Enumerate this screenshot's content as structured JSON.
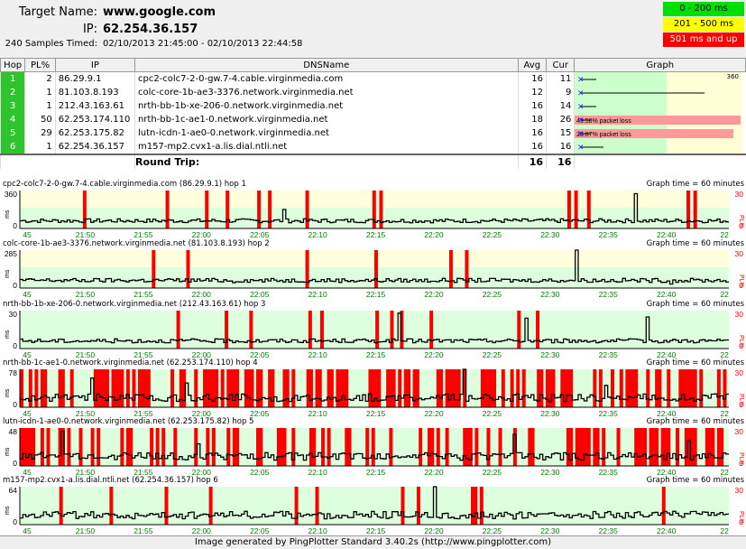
{
  "header": {
    "target_name_label": "Target Name:",
    "target_name": "www.google.com",
    "ip_label": "IP:",
    "ip": "62.254.36.157",
    "samples_label": "240 Samples Timed:",
    "samples_range": "02/10/2013 21:45:00 - 02/10/2013 22:44:58"
  },
  "legend": {
    "items": [
      {
        "label": "0 - 200 ms",
        "color": "#00e000"
      },
      {
        "label": "201 - 500 ms",
        "color": "#ffff00"
      },
      {
        "label": "501 ms and up",
        "color": "#ff0000"
      }
    ]
  },
  "table": {
    "columns": [
      "Hop",
      "PL%",
      "IP",
      "DNSName",
      "Avg",
      "Cur",
      "Graph"
    ],
    "graph_max_label": "360",
    "rows": [
      {
        "hop": "1",
        "pl": "2",
        "ip": "86.29.9.1",
        "dns": "cpc2-colc7-2-0-gw.7-4.cable.virginmedia.com",
        "avg": "16",
        "cur": "11",
        "loss_label": ""
      },
      {
        "hop": "2",
        "pl": "1",
        "ip": "81.103.8.193",
        "dns": "colc-core-1b-ae3-3376.network.virginmedia.net",
        "avg": "12",
        "cur": "9",
        "loss_label": ""
      },
      {
        "hop": "3",
        "pl": "1",
        "ip": "212.43.163.61",
        "dns": "nrth-bb-1b-xe-206-0.network.virginmedia.net",
        "avg": "16",
        "cur": "14",
        "loss_label": ""
      },
      {
        "hop": "4",
        "pl": "50",
        "ip": "62.253.174.110",
        "dns": "nrth-bb-1c-ae1-0.network.virginmedia.net",
        "avg": "18",
        "cur": "26",
        "loss_label": "49.58% packet loss"
      },
      {
        "hop": "5",
        "pl": "29",
        "ip": "62.253.175.82",
        "dns": "lutn-icdn-1-ae0-0.network.virginmedia.net",
        "avg": "16",
        "cur": "15",
        "loss_label": "28.87% packet loss"
      },
      {
        "hop": "6",
        "pl": "1",
        "ip": "62.254.36.157",
        "dns": "m157-mp2.cvx1-a.lis.dial.ntli.net",
        "avg": "16",
        "cur": "16",
        "loss_label": ""
      }
    ],
    "round_trip_label": "Round Trip:",
    "round_trip_avg": "16",
    "round_trip_cur": "16"
  },
  "time_ticks": [
    "45",
    "21:50",
    "21:55",
    "22:00",
    "22:05",
    "22:10",
    "22:15",
    "22:20",
    "22:25",
    "22:30",
    "22:35",
    "22:40",
    "22"
  ],
  "charts": [
    {
      "title": "cpc2-colc7-2-0-gw.7-4.cable.virginmedia.com (86.29.9.1) hop 1",
      "graph_time": "Graph time = 60 minutes",
      "ymax": "360",
      "ymax_val": 360,
      "ylow": "0",
      "pl_max": "30",
      "pl_low": "0",
      "pl_axis": "PL%",
      "unit": "ms",
      "losses": [
        64,
        148,
        188,
        209,
        241,
        252,
        290,
        358,
        365,
        556,
        563,
        576,
        677,
        684
      ],
      "spikes": [
        [
          89,
          180
        ],
        [
          208,
          330
        ],
        [
          246,
          160
        ]
      ]
    },
    {
      "title": "colc-core-1b-ae3-3376.network.virginmedia.net (81.103.8.193) hop 2",
      "graph_time": "Graph time = 60 minutes",
      "ymax": "285",
      "ymax_val": 285,
      "ylow": "0",
      "pl_max": "30",
      "pl_low": "0",
      "pl_axis": "PL%",
      "unit": "ms",
      "losses": [
        134,
        169,
        290,
        360,
        436,
        452
      ],
      "spikes": [
        [
          188,
          285
        ],
        [
          72,
          40
        ],
        [
          220,
          30
        ]
      ]
    },
    {
      "title": "nrth-bb-1b-xe-206-0.network.virginmedia.net (212.43.163.61) hop 3",
      "graph_time": "Graph time = 60 minutes",
      "ymax": "30",
      "ymax_val": 30,
      "ylow": "0",
      "pl_max": "30",
      "pl_low": "0",
      "pl_axis": "PL%",
      "unit": "ms",
      "losses": [
        159,
        208,
        233,
        293,
        305,
        361,
        376,
        386,
        416,
        505,
        524
      ],
      "spikes": [
        [
          128,
          28
        ],
        [
          171,
          24
        ],
        [
          212,
          25
        ],
        [
          241,
          26
        ],
        [
          288,
          22
        ]
      ]
    },
    {
      "title": "nrth-bb-1c-ae1-0.network.virginmedia.net (62.253.174.110) hop 4",
      "graph_time": "Graph time = 60 minutes",
      "ymax": "78",
      "ymax_val": 78,
      "ylow": "0",
      "pl_max": "30",
      "pl_low": "0",
      "pl_axis": "PL%",
      "unit": "ms",
      "losses": [],
      "spikes": [
        [
          24,
          60
        ],
        [
          56,
          50
        ],
        [
          150,
          78
        ],
        [
          198,
          45
        ]
      ]
    },
    {
      "title": "lutn-icdn-1-ae0-0.network.virginmedia.net (62.253.175.82) hop 5",
      "graph_time": "Graph time = 60 minutes",
      "ymax": "48",
      "ymax_val": 48,
      "ylow": "0",
      "pl_max": "30",
      "pl_low": "0",
      "pl_axis": "PL%",
      "unit": "ms",
      "losses": [],
      "spikes": [
        [
          14,
          44
        ],
        [
          60,
          28
        ],
        [
          167,
          40
        ],
        [
          226,
          32
        ]
      ]
    },
    {
      "title": "m157-mp2.cvx1-a.lis.dial.ntli.net (62.254.36.157) hop 6",
      "graph_time": "Graph time = 60 minutes",
      "ymax": "64",
      "ymax_val": 64,
      "ylow": "0",
      "pl_max": "30",
      "pl_low": "0",
      "pl_axis": "PL%",
      "unit": "ms",
      "losses": [
        40,
        91,
        147,
        192,
        279,
        300,
        387,
        403,
        458,
        461,
        467,
        652
      ],
      "spikes": [
        [
          140,
          64
        ],
        [
          180,
          20
        ],
        [
          206,
          14
        ],
        [
          236,
          18
        ]
      ]
    }
  ],
  "footer": "Image generated by PingPlotter Standard 3.40.2s (http://www.pingplotter.com)"
}
